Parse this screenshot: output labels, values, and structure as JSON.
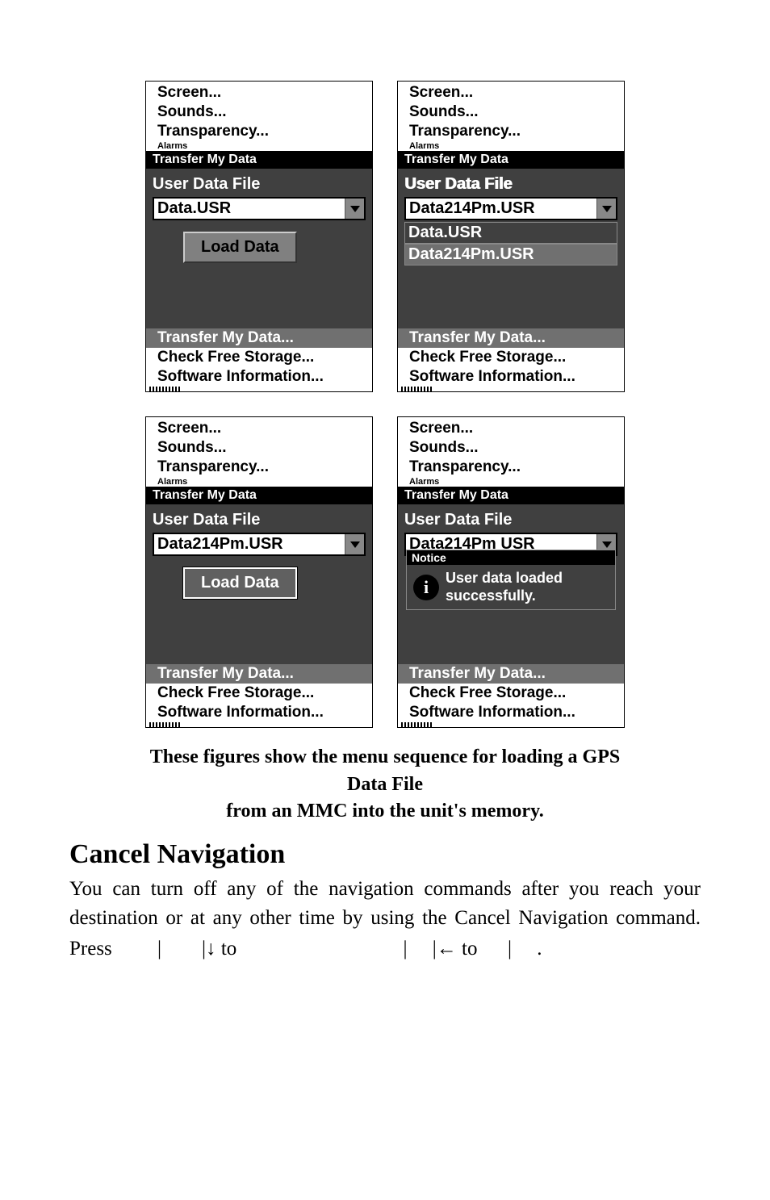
{
  "panels": {
    "common_menu": [
      "Screen...",
      "Sounds...",
      "Transparency..."
    ],
    "menu_cut": "Alarms",
    "header": "Transfer My Data",
    "label": "User Data File",
    "file_a": "Data.USR",
    "file_b": "Data214Pm.USR",
    "file_b2": "Data214Pm USR",
    "load_label": "Load Data",
    "options": [
      "Data.USR",
      "Data214Pm.USR"
    ],
    "bottom": [
      "Transfer My Data...",
      "Check Free Storage...",
      "Software Information..."
    ],
    "notice_header": "Notice",
    "notice_text1": "User data loaded",
    "notice_text2": "successfully."
  },
  "caption_line1": "These figures show the menu sequence for loading a GPS Data File",
  "caption_line2": "from an MMC into the unit's memory.",
  "heading": "Cancel Navigation",
  "body_pre": "You can turn off any of the navigation commands after you reach your destination or at any other time by using the Cancel Navigation command. Press ",
  "body_seg1": "to",
  "body_seg2": "to",
  "body_dot": "."
}
